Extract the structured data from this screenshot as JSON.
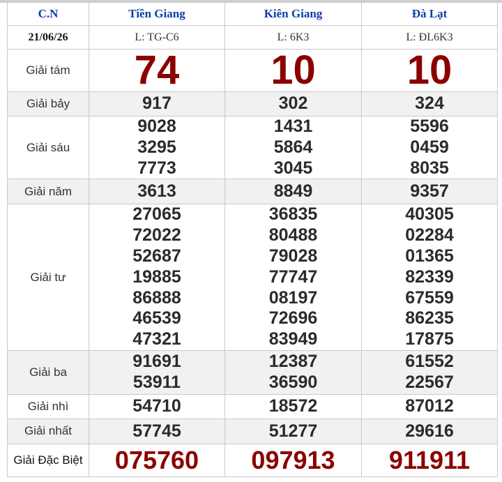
{
  "header": {
    "day": "C.N",
    "provinces": [
      "Tiền Giang",
      "Kiên Giang",
      "Đà Lạt"
    ],
    "date": "21/06/26",
    "series": [
      "L: TG-C6",
      "L: 6K3",
      "L: ĐL6K3"
    ]
  },
  "prizes": {
    "g8": {
      "label": "Giải tám",
      "values": [
        [
          "74"
        ],
        [
          "10"
        ],
        [
          "10"
        ]
      ]
    },
    "g7": {
      "label": "Giải bảy",
      "values": [
        [
          "917"
        ],
        [
          "302"
        ],
        [
          "324"
        ]
      ]
    },
    "g6": {
      "label": "Giải sáu",
      "values": [
        [
          "9028",
          "3295",
          "7773"
        ],
        [
          "1431",
          "5864",
          "3045"
        ],
        [
          "5596",
          "0459",
          "8035"
        ]
      ]
    },
    "g5": {
      "label": "Giải năm",
      "values": [
        [
          "3613"
        ],
        [
          "8849"
        ],
        [
          "9357"
        ]
      ]
    },
    "g4": {
      "label": "Giải tư",
      "values": [
        [
          "27065",
          "72022",
          "52687",
          "19885",
          "86888",
          "46539",
          "47321"
        ],
        [
          "36835",
          "80488",
          "79028",
          "77747",
          "08197",
          "72696",
          "83949"
        ],
        [
          "40305",
          "02284",
          "01365",
          "82339",
          "67559",
          "86235",
          "17875"
        ]
      ]
    },
    "g3": {
      "label": "Giải ba",
      "values": [
        [
          "91691",
          "53911"
        ],
        [
          "12387",
          "36590"
        ],
        [
          "61552",
          "22567"
        ]
      ]
    },
    "g2": {
      "label": "Giải nhì",
      "values": [
        [
          "54710"
        ],
        [
          "18572"
        ],
        [
          "87012"
        ]
      ]
    },
    "g1": {
      "label": "Giải nhất",
      "values": [
        [
          "57745"
        ],
        [
          "51277"
        ],
        [
          "29616"
        ]
      ]
    },
    "db": {
      "label": "Giải Đặc Biệt",
      "values": [
        [
          "075760"
        ],
        [
          "097913"
        ],
        [
          "911911"
        ]
      ]
    }
  },
  "colors": {
    "header_text": "#0b3ea8",
    "highlight_number": "#8b0000",
    "number": "#2b2b2b",
    "alt_row_bg": "#f1f1f1",
    "border": "#c9c9c9"
  }
}
